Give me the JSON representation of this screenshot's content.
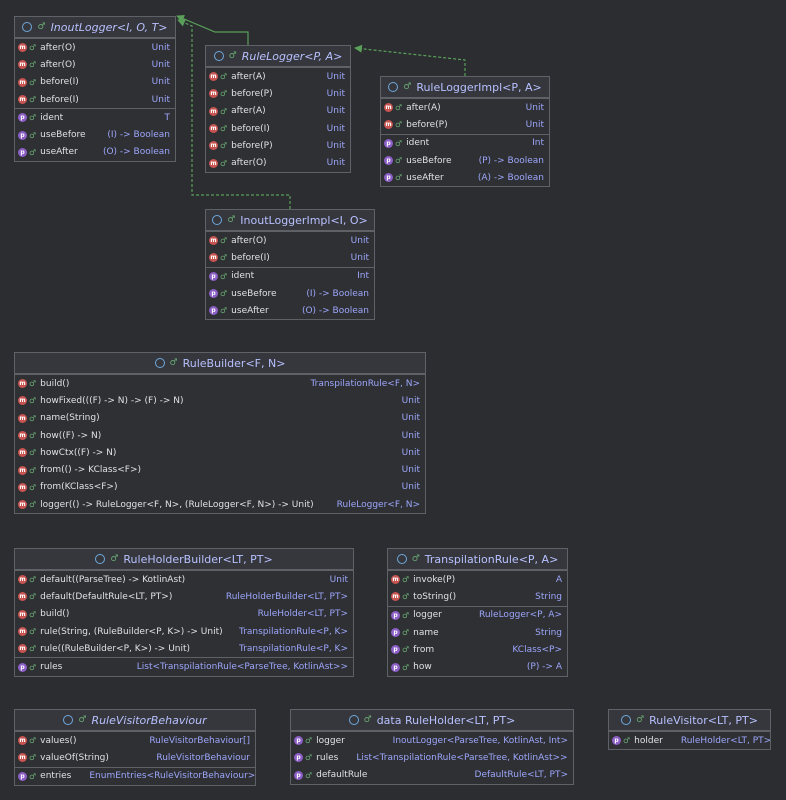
{
  "colors": {
    "background": "#2b2d30",
    "method_icon": "#c75450",
    "property_icon": "#8c5fc6",
    "type_text": "#9da6fb",
    "edge": "#5aa05a"
  },
  "classes": [
    {
      "id": "inout-logger",
      "title": "InoutLogger<I, O, T>",
      "icon": "interface-icon",
      "sections": [
        [
          {
            "k": "m",
            "name": "after(O)",
            "type": "Unit"
          },
          {
            "k": "m",
            "name": "after(O)",
            "type": "Unit"
          },
          {
            "k": "m",
            "name": "before(I)",
            "type": "Unit"
          },
          {
            "k": "m",
            "name": "before(I)",
            "type": "Unit"
          }
        ],
        [
          {
            "k": "p",
            "name": "ident",
            "type": "T"
          },
          {
            "k": "p",
            "name": "useBefore",
            "type": "(I) -> Boolean"
          },
          {
            "k": "p",
            "name": "useAfter",
            "type": "(O) -> Boolean"
          }
        ]
      ]
    },
    {
      "id": "rule-logger",
      "title": "RuleLogger<P, A>",
      "icon": "interface-icon",
      "sections": [
        [
          {
            "k": "m",
            "name": "after(A)",
            "type": "Unit"
          },
          {
            "k": "m",
            "name": "before(P)",
            "type": "Unit"
          },
          {
            "k": "m",
            "name": "after(A)",
            "type": "Unit"
          },
          {
            "k": "m",
            "name": "before(I)",
            "type": "Unit"
          },
          {
            "k": "m",
            "name": "before(P)",
            "type": "Unit"
          },
          {
            "k": "m",
            "name": "after(O)",
            "type": "Unit"
          }
        ]
      ]
    },
    {
      "id": "rule-logger-impl",
      "title": "RuleLoggerImpl<P, A>",
      "icon": "class-icon",
      "plain": true,
      "sections": [
        [
          {
            "k": "m",
            "name": "after(A)",
            "type": "Unit"
          },
          {
            "k": "m",
            "name": "before(P)",
            "type": "Unit"
          }
        ],
        [
          {
            "k": "p",
            "name": "ident",
            "type": "Int"
          },
          {
            "k": "p",
            "name": "useBefore",
            "type": "(P) -> Boolean"
          },
          {
            "k": "p",
            "name": "useAfter",
            "type": "(A) -> Boolean"
          }
        ]
      ]
    },
    {
      "id": "inout-logger-impl",
      "title": "InoutLoggerImpl<I, O>",
      "icon": "class-icon",
      "plain": true,
      "sections": [
        [
          {
            "k": "m",
            "name": "after(O)",
            "type": "Unit"
          },
          {
            "k": "m",
            "name": "before(I)",
            "type": "Unit"
          }
        ],
        [
          {
            "k": "p",
            "name": "ident",
            "type": "Int"
          },
          {
            "k": "p",
            "name": "useBefore",
            "type": "(I) -> Boolean"
          },
          {
            "k": "p",
            "name": "useAfter",
            "type": "(O) -> Boolean"
          }
        ]
      ]
    },
    {
      "id": "rule-builder",
      "title": "RuleBuilder<F, N>",
      "icon": "class-icon",
      "plain": true,
      "sections": [
        [
          {
            "k": "m",
            "name": "build()",
            "type": "TranspilationRule<F, N>"
          },
          {
            "k": "m",
            "name": "howFixed(((F) -> N) -> (F) -> N)",
            "type": "Unit"
          },
          {
            "k": "m",
            "name": "name(String)",
            "type": "Unit"
          },
          {
            "k": "m",
            "name": "how((F) -> N)",
            "type": "Unit"
          },
          {
            "k": "m",
            "name": "howCtx((F) -> N)",
            "type": "Unit"
          },
          {
            "k": "m",
            "name": "from(() -> KClass<F>)",
            "type": "Unit"
          },
          {
            "k": "m",
            "name": "from(KClass<F>)",
            "type": "Unit"
          },
          {
            "k": "m",
            "name": "logger(() -> RuleLogger<F, N>, (RuleLogger<F, N>) -> Unit)",
            "type": "RuleLogger<F, N>"
          }
        ]
      ]
    },
    {
      "id": "rule-holder-builder",
      "title": "RuleHolderBuilder<LT, PT>",
      "icon": "class-icon",
      "plain": true,
      "sections": [
        [
          {
            "k": "m",
            "name": "default((ParseTree) -> KotlinAst)",
            "type": "Unit"
          },
          {
            "k": "m",
            "name": "default(DefaultRule<LT, PT>)",
            "type": "RuleHolderBuilder<LT, PT>"
          },
          {
            "k": "m",
            "name": "build()",
            "type": "RuleHolder<LT, PT>"
          },
          {
            "k": "m",
            "name": "rule(String, (RuleBuilder<P, K>) -> Unit)",
            "type": "TranspilationRule<P, K>"
          },
          {
            "k": "m",
            "name": "rule((RuleBuilder<P, K>) -> Unit)",
            "type": "TranspilationRule<P, K>"
          }
        ],
        [
          {
            "k": "p",
            "name": "rules",
            "type": "List<TranspilationRule<ParseTree, KotlinAst>>"
          }
        ]
      ]
    },
    {
      "id": "transpilation-rule",
      "title": "TranspilationRule<P, A>",
      "icon": "class-icon",
      "plain": true,
      "sections": [
        [
          {
            "k": "m",
            "name": "invoke(P)",
            "type": "A"
          },
          {
            "k": "m",
            "name": "toString()",
            "type": "String"
          }
        ],
        [
          {
            "k": "p",
            "name": "logger",
            "type": "RuleLogger<P, A>"
          },
          {
            "k": "p",
            "name": "name",
            "type": "String"
          },
          {
            "k": "p",
            "name": "from",
            "type": "KClass<P>"
          },
          {
            "k": "p",
            "name": "how",
            "type": "(P) -> A"
          }
        ]
      ]
    },
    {
      "id": "rule-visitor-behaviour",
      "title": "RuleVisitorBehaviour",
      "icon": "enum-icon",
      "sections": [
        [
          {
            "k": "m",
            "name": "values()",
            "type": "RuleVisitorBehaviour[]"
          },
          {
            "k": "m",
            "name": "valueOf(String)",
            "type": "RuleVisitorBehaviour"
          }
        ],
        [
          {
            "k": "p",
            "name": "entries",
            "type": "EnumEntries<RuleVisitorBehaviour>",
            "near": true
          }
        ]
      ]
    },
    {
      "id": "rule-holder",
      "title": "data  RuleHolder<LT, PT>",
      "icon": "class-icon",
      "plain": true,
      "sections": [
        [
          {
            "k": "p",
            "name": "logger",
            "type": "InoutLogger<ParseTree, KotlinAst, Int>"
          },
          {
            "k": "p",
            "name": "rules",
            "type": "List<TranspilationRule<ParseTree, KotlinAst>>",
            "near": true
          },
          {
            "k": "p",
            "name": "defaultRule",
            "type": "DefaultRule<LT, PT>"
          }
        ]
      ]
    },
    {
      "id": "rule-visitor",
      "title": "RuleVisitor<LT, PT>",
      "icon": "class-icon",
      "plain": true,
      "sections": [
        [
          {
            "k": "p",
            "name": "holder",
            "type": "RuleHolder<LT, PT>",
            "near": true
          }
        ]
      ]
    }
  ]
}
